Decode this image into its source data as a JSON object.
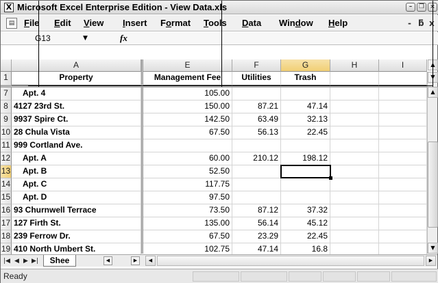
{
  "window": {
    "title": "Microsoft Excel Enterprise Edition - View Data.xls",
    "app_icon": "excel-icon",
    "buttons": [
      "minimize",
      "restore",
      "close"
    ]
  },
  "menubar": {
    "items": [
      {
        "first": "F",
        "rest": "ile"
      },
      {
        "first": "E",
        "rest": "dit"
      },
      {
        "first": "V",
        "rest": "iew"
      },
      {
        "first": "I",
        "rest": "nsert"
      },
      {
        "first": "",
        "pre": "F",
        "mid": "o",
        "rest": "rmat"
      },
      {
        "first": "T",
        "rest": "ools"
      },
      {
        "first": "D",
        "rest": "ata"
      },
      {
        "first": "",
        "pre": "Win",
        "mid": "d",
        "rest": "ow"
      },
      {
        "first": "H",
        "rest": "elp"
      }
    ],
    "labels": [
      "File",
      "Edit",
      "View",
      "Insert",
      "Format",
      "Tools",
      "Data",
      "Window",
      "Help"
    ],
    "mdi_minimize": "_",
    "mdi_restore": "̅",
    "mdi_close": "x"
  },
  "formula_bar": {
    "name_box": "G13",
    "fx": "fx",
    "content": ""
  },
  "columns": [
    "A",
    "E",
    "F",
    "G",
    "H",
    "I"
  ],
  "header_row": {
    "row": "1",
    "cells": [
      "Property",
      "Management Fee",
      "Utilities",
      "Trash",
      "",
      ""
    ]
  },
  "rows": [
    {
      "row": "7",
      "property": "Apt. 4",
      "fee": "105.00",
      "utilities": "",
      "trash": "",
      "indent": true
    },
    {
      "row": "8",
      "property": "4127 23rd St.",
      "fee": "150.00",
      "utilities": "87.21",
      "trash": "47.14",
      "indent": false
    },
    {
      "row": "9",
      "property": "9937 Spire Ct.",
      "fee": "142.50",
      "utilities": "63.49",
      "trash": "32.13",
      "indent": false
    },
    {
      "row": "10",
      "property": "28 Chula Vista",
      "fee": "67.50",
      "utilities": "56.13",
      "trash": "22.45",
      "indent": false
    },
    {
      "row": "11",
      "property": "999 Cortland Ave.",
      "fee": "",
      "utilities": "",
      "trash": "",
      "indent": false
    },
    {
      "row": "12",
      "property": "Apt. A",
      "fee": "60.00",
      "utilities": "210.12",
      "trash": "198.12",
      "indent": true
    },
    {
      "row": "13",
      "property": "Apt. B",
      "fee": "52.50",
      "utilities": "",
      "trash": "",
      "indent": true
    },
    {
      "row": "14",
      "property": "Apt. C",
      "fee": "117.75",
      "utilities": "",
      "trash": "",
      "indent": true
    },
    {
      "row": "15",
      "property": "Apt. D",
      "fee": "97.50",
      "utilities": "",
      "trash": "",
      "indent": true
    },
    {
      "row": "16",
      "property": "93 Churnwell Terrace",
      "fee": "73.50",
      "utilities": "87.12",
      "trash": "37.32",
      "indent": false
    },
    {
      "row": "17",
      "property": "127 Firth St.",
      "fee": "135.00",
      "utilities": "56.14",
      "trash": "45.12",
      "indent": false
    },
    {
      "row": "18",
      "property": "239 Ferrow Dr.",
      "fee": "67.50",
      "utilities": "23.29",
      "trash": "22.45",
      "indent": false
    },
    {
      "row": "19",
      "property": "410 North Umbert St.",
      "fee": "102.75",
      "utilities": "47.14",
      "trash": "16.8",
      "indent": false
    }
  ],
  "active_cell": "G13",
  "sheet_tab": "Shee",
  "status": "Ready",
  "icons": {
    "scroll_up": "▲",
    "scroll_down": "▼",
    "scroll_left": "◀",
    "scroll_right": "▶",
    "tab_first": "|◀",
    "tab_prev": "◀",
    "tab_next": "▶",
    "tab_last": "▶|",
    "dropdown": "▼"
  }
}
